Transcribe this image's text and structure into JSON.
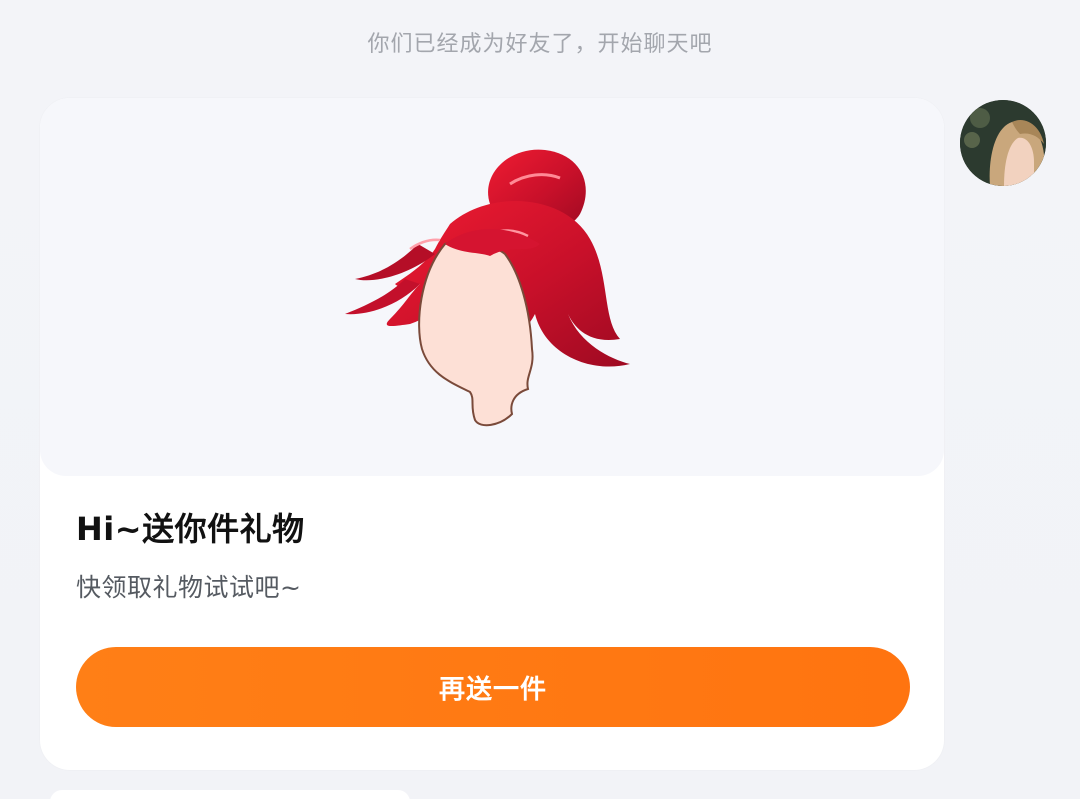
{
  "chat": {
    "system_message": "你们已经成为好友了，开始聊天吧"
  },
  "gift_card": {
    "title": "Hi~送你件礼物",
    "subtitle": "快领取礼物试试吧~",
    "button_label": "再送一件",
    "button_color": "#ff7a14",
    "image_icon": "red-hair-wig-gift-icon"
  },
  "avatar": {
    "icon": "user-avatar-photo"
  }
}
